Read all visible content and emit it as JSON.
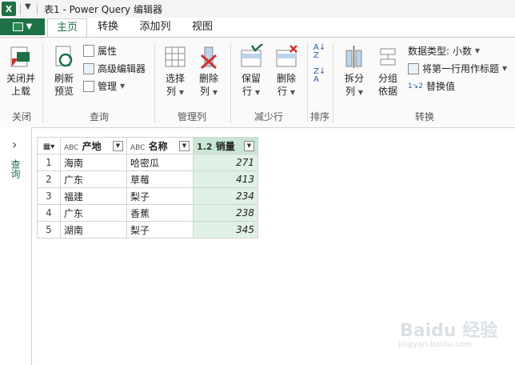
{
  "window": {
    "title": "表1 - Power Query 编辑器",
    "logo": "X"
  },
  "tabs": [
    "主页",
    "转换",
    "添加列",
    "视图"
  ],
  "ribbon": {
    "close_group": {
      "button": "关闭并\n上载",
      "label": "关闭"
    },
    "query_group": {
      "refresh": "刷新\n预览",
      "properties": "属性",
      "advanced_editor": "高级编辑器",
      "manage": "管理",
      "label": "查询"
    },
    "manage_cols_group": {
      "choose_cols": "选择\n列",
      "remove_cols": "删除\n列",
      "label": "管理列"
    },
    "reduce_rows_group": {
      "keep_rows": "保留\n行",
      "remove_rows": "删除\n行",
      "label": "减少行"
    },
    "sort_group": {
      "label": "排序"
    },
    "transform_group": {
      "split_col": "拆分\n列",
      "group_by": "分组\n依据",
      "data_type": "数据类型: 小数",
      "first_row_header": "将第一行用作标题",
      "replace_values": "替换值",
      "label": "转换"
    }
  },
  "nav": {
    "label": "查询"
  },
  "table": {
    "columns": [
      {
        "type": "ABC",
        "name": "产地"
      },
      {
        "type": "ABC",
        "name": "名称"
      },
      {
        "type": "1.2",
        "name": "销量"
      }
    ],
    "rows": [
      {
        "n": "1",
        "a": "海南",
        "b": "哈密瓜",
        "c": "271"
      },
      {
        "n": "2",
        "a": "广东",
        "b": "草莓",
        "c": "413"
      },
      {
        "n": "3",
        "a": "福建",
        "b": "梨子",
        "c": "234"
      },
      {
        "n": "4",
        "a": "广东",
        "b": "香蕉",
        "c": "238"
      },
      {
        "n": "5",
        "a": "湖南",
        "b": "梨子",
        "c": "345"
      }
    ]
  },
  "watermark": {
    "main": "Baidu 经验",
    "sub": "jingyan.baidu.com"
  }
}
